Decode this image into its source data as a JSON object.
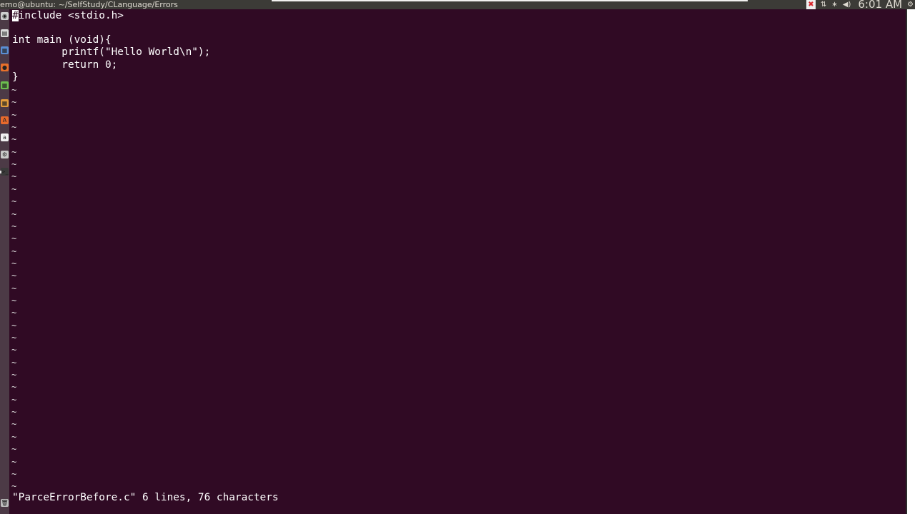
{
  "panel": {
    "window_title": "emo@ubuntu: ~/SelfStudy/CLanguage/Errors",
    "clock": "6:01 AM"
  },
  "launcher": {
    "items": [
      {
        "icon": "dash-icon",
        "glyph": "◉",
        "color": "#cfcfcf"
      },
      {
        "icon": "files-icon",
        "glyph": "▤",
        "color": "#d9d9d9"
      },
      {
        "icon": "writer-icon",
        "glyph": "▦",
        "color": "#5b8fd4"
      },
      {
        "icon": "firefox-icon",
        "glyph": "●",
        "color": "#e8702a"
      },
      {
        "icon": "calc-icon",
        "glyph": "▦",
        "color": "#6cbf4f"
      },
      {
        "icon": "impress-icon",
        "glyph": "▦",
        "color": "#e39c3b"
      },
      {
        "icon": "software-center-icon",
        "glyph": "A",
        "color": "#e86a2c"
      },
      {
        "icon": "amazon-icon",
        "glyph": "a",
        "color": "#f2f2f2"
      },
      {
        "icon": "settings-icon",
        "glyph": "⚙",
        "color": "#c9c9c9"
      },
      {
        "icon": "terminal-icon",
        "glyph": ">_",
        "color": "#3a3a3a"
      },
      {
        "icon": "trash-icon",
        "glyph": "🗑",
        "color": "#bdbdbd"
      }
    ]
  },
  "editor": {
    "cursor_char": "#",
    "lines": [
      "include <stdio.h>",
      "",
      "int main (void){",
      "        printf(\"Hello World\\n\");",
      "        return 0;",
      "}"
    ],
    "tilde": "~",
    "status": "\"ParceErrorBefore.c\" 6 lines, 76 characters"
  }
}
